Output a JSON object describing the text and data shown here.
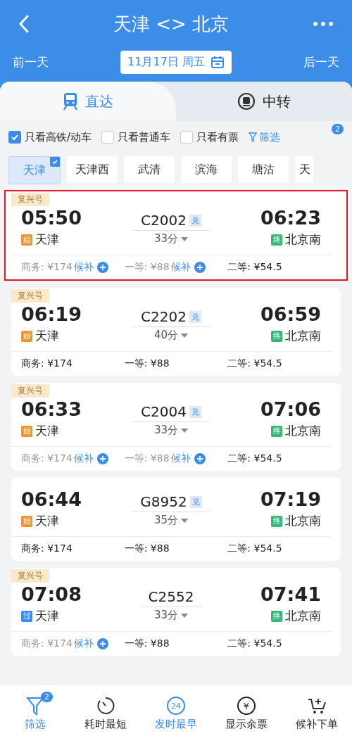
{
  "header": {
    "title": "天津 <> 北京",
    "prev_day": "前一天",
    "date": "11月17日 周五",
    "next_day": "后一天"
  },
  "tabs": [
    {
      "label": "直达",
      "selected": true
    },
    {
      "label": "中转",
      "selected": false
    }
  ],
  "filters": [
    {
      "label": "只看高铁/动车",
      "checked": true
    },
    {
      "label": "只看普通车",
      "checked": false
    },
    {
      "label": "只看有票",
      "checked": false
    }
  ],
  "filter_link": {
    "label": "筛选",
    "badge": "2"
  },
  "stations": [
    {
      "label": "天津",
      "selected": true
    },
    {
      "label": "天津西",
      "selected": false
    },
    {
      "label": "武清",
      "selected": false
    },
    {
      "label": "滨海",
      "selected": false
    },
    {
      "label": "塘沽",
      "selected": false
    },
    {
      "label": "天",
      "selected": false
    }
  ],
  "trains": [
    {
      "highlighted": true,
      "badge": "复兴号",
      "depart": "05:50",
      "train_no": "C2002",
      "tag": "兑",
      "arrive": "06:23",
      "from_tag": {
        "text": "始",
        "color": "#f0952f"
      },
      "from": "天津",
      "duration": "33分",
      "to_tag": "终",
      "to": "北京南",
      "seats": [
        {
          "label": "商务: ¥174",
          "available": false,
          "waitlist": "候补"
        },
        {
          "label": "一等: ¥88",
          "available": false,
          "waitlist": "候补"
        },
        {
          "label": "二等: ¥54.5",
          "available": true
        }
      ]
    },
    {
      "highlighted": false,
      "badge": "复兴号",
      "depart": "06:19",
      "train_no": "C2202",
      "tag": "兑",
      "arrive": "06:59",
      "from_tag": {
        "text": "始",
        "color": "#f0952f"
      },
      "from": "天津",
      "duration": "40分",
      "to_tag": "终",
      "to": "北京南",
      "seats": [
        {
          "label": "商务: ¥174",
          "available": true
        },
        {
          "label": "一等: ¥88",
          "available": true
        },
        {
          "label": "二等: ¥54.5",
          "available": true
        }
      ]
    },
    {
      "highlighted": false,
      "badge": "复兴号",
      "depart": "06:33",
      "train_no": "C2004",
      "tag": "兑",
      "arrive": "07:06",
      "from_tag": {
        "text": "始",
        "color": "#f0952f"
      },
      "from": "天津",
      "duration": "33分",
      "to_tag": "终",
      "to": "北京南",
      "seats": [
        {
          "label": "商务: ¥174",
          "available": false,
          "waitlist": "候补"
        },
        {
          "label": "一等: ¥88",
          "available": false,
          "waitlist": "候补"
        },
        {
          "label": "二等: ¥54.5",
          "available": true
        }
      ]
    },
    {
      "highlighted": false,
      "depart": "06:44",
      "train_no": "G8952",
      "tag": "兑",
      "arrive": "07:19",
      "from_tag": {
        "text": "始",
        "color": "#f0952f"
      },
      "from": "天津",
      "duration": "35分",
      "to_tag": "终",
      "to": "北京南",
      "seats": [
        {
          "label": "商务: ¥174",
          "available": true
        },
        {
          "label": "一等: ¥88",
          "available": true
        },
        {
          "label": "二等: ¥54.5",
          "available": true
        }
      ]
    },
    {
      "highlighted": false,
      "badge": "复兴号",
      "depart": "07:08",
      "train_no": "C2552",
      "arrive": "07:41",
      "from_tag": {
        "text": "过",
        "color": "#3b8de8"
      },
      "from": "天津",
      "duration": "33分",
      "to_tag": "终",
      "to": "北京南",
      "seats": [
        {
          "label": "商务: ¥174",
          "available": false,
          "waitlist": "候补"
        },
        {
          "label": "一等: ¥88",
          "available": true
        },
        {
          "label": "二等: ¥54.5",
          "available": true
        }
      ]
    }
  ],
  "bottom_bar": [
    {
      "kind": "filter",
      "label": "筛选",
      "badge": "2",
      "selected": true
    },
    {
      "kind": "clock",
      "label": "耗时最短",
      "selected": false
    },
    {
      "kind": "early",
      "label": "发时最早",
      "icon_text": "24",
      "selected": true
    },
    {
      "kind": "money",
      "label": "显示余票",
      "icon_text": "¥",
      "selected": false
    },
    {
      "kind": "cart",
      "label": "候补下单",
      "selected": false
    }
  ]
}
